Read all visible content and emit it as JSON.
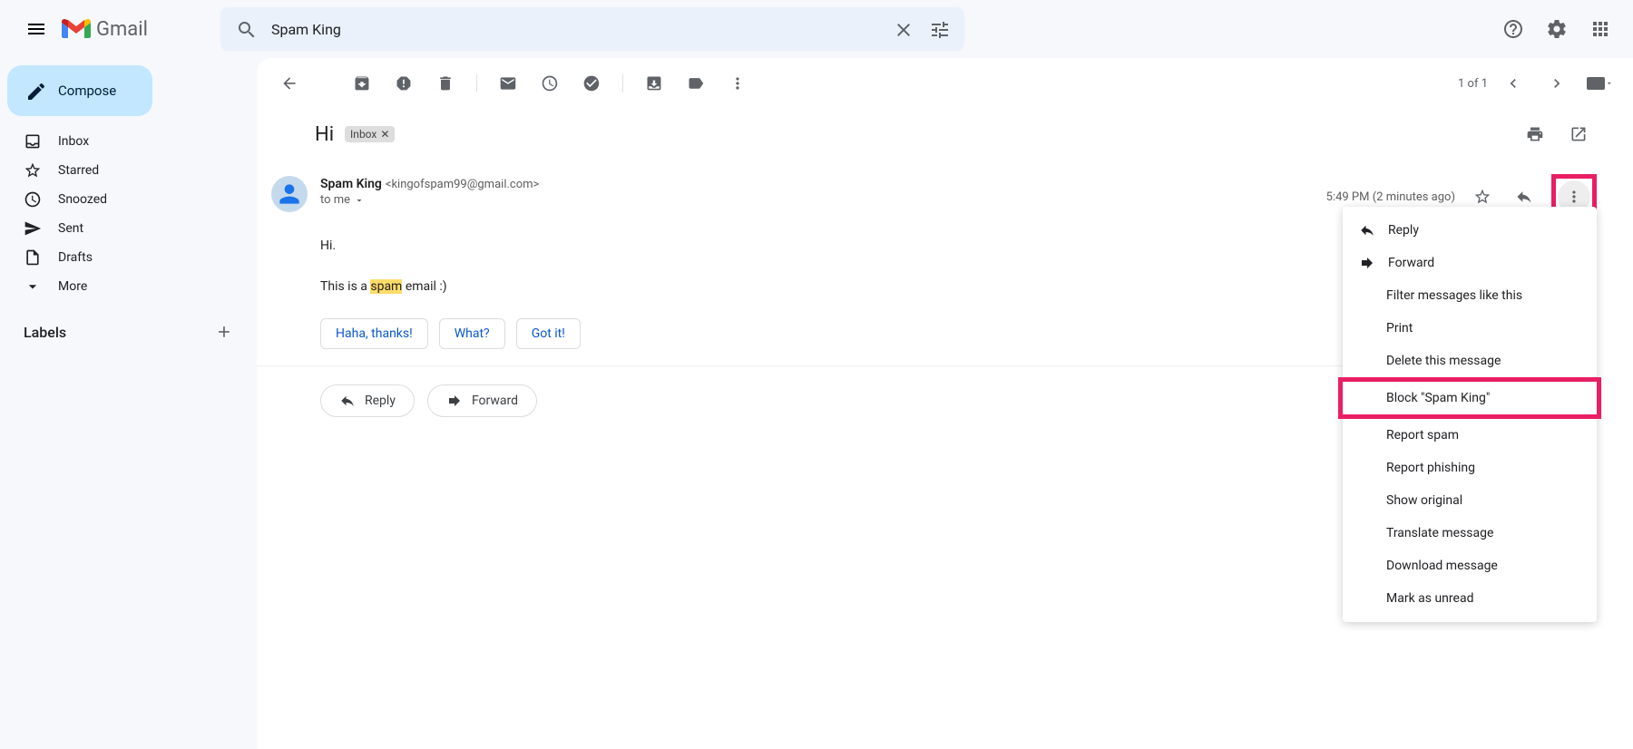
{
  "header": {
    "app_name": "Gmail",
    "search_value": "Spam King"
  },
  "sidebar": {
    "compose": "Compose",
    "items": [
      {
        "label": "Inbox"
      },
      {
        "label": "Starred"
      },
      {
        "label": "Snoozed"
      },
      {
        "label": "Sent"
      },
      {
        "label": "Drafts"
      },
      {
        "label": "More"
      }
    ],
    "labels_heading": "Labels"
  },
  "toolbar": {
    "pagination": "1 of 1"
  },
  "message": {
    "subject": "Hi",
    "label": "Inbox",
    "sender_name": "Spam King",
    "sender_email": "<kingofspam99@gmail.com>",
    "to_line": "to me",
    "timestamp": "5:49 PM (2 minutes ago)",
    "body_line1": "Hi.",
    "body_prefix": "This is a ",
    "body_highlight": "spam",
    "body_suffix": " email :)"
  },
  "smart_replies": [
    "Haha, thanks!",
    "What?",
    "Got it!"
  ],
  "actions": {
    "reply": "Reply",
    "forward": "Forward"
  },
  "dropdown": {
    "reply": "Reply",
    "forward": "Forward",
    "filter": "Filter messages like this",
    "print": "Print",
    "delete": "Delete this message",
    "block": "Block \"Spam King\"",
    "report_spam": "Report spam",
    "report_phishing": "Report phishing",
    "show_original": "Show original",
    "translate": "Translate message",
    "download": "Download message",
    "mark_unread": "Mark as unread"
  }
}
